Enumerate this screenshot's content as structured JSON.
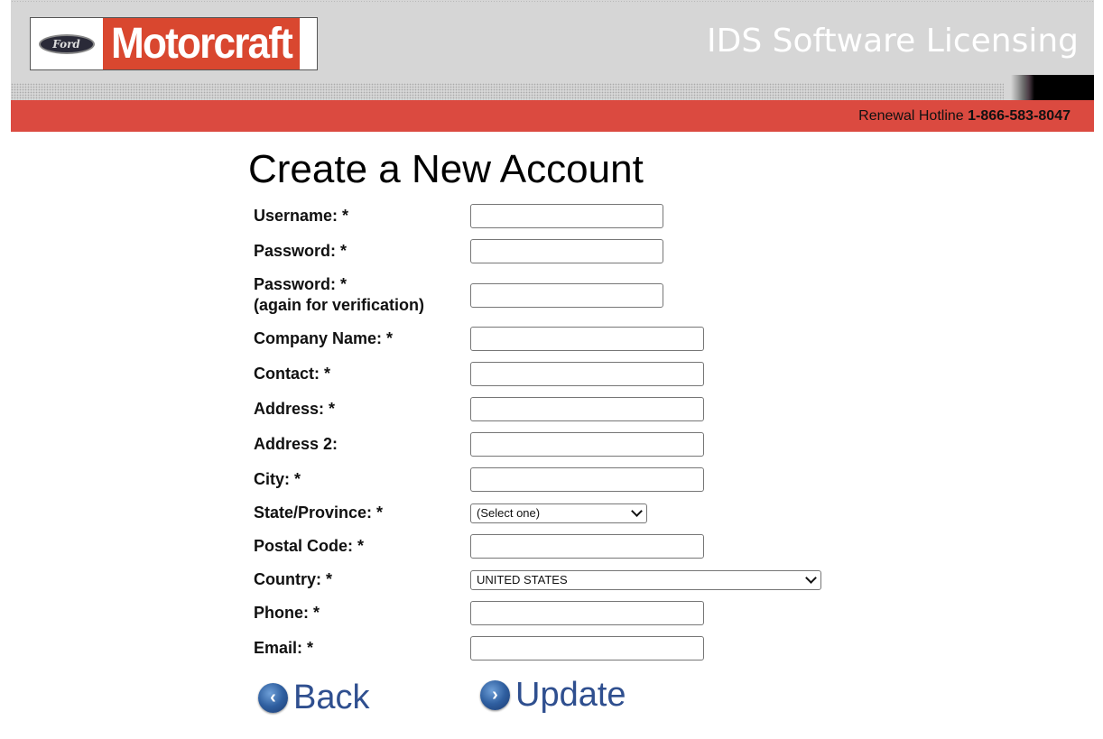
{
  "header": {
    "logo_brand": "Motorcraft",
    "logo_ford": "Ford",
    "app_title": "IDS Software Licensing",
    "hotline_label": "Renewal Hotline",
    "hotline_number": "1-866-583-8047"
  },
  "page": {
    "title": "Create a New Account"
  },
  "form": {
    "username_label": "Username: *",
    "password_label": "Password: *",
    "password2_label_line1": "Password: *",
    "password2_label_line2": "(again for verification)",
    "company_label": "Company Name: *",
    "contact_label": "Contact: *",
    "address_label": "Address: *",
    "address2_label": "Address 2:",
    "city_label": "City: *",
    "state_label": "State/Province: *",
    "state_value": "(Select one)",
    "postal_label": "Postal Code: *",
    "country_label": "Country: *",
    "country_value": "UNITED STATES",
    "phone_label": "Phone: *",
    "email_label": "Email: *"
  },
  "actions": {
    "back_label": "Back",
    "back_icon": "chevron-left-circle-icon",
    "update_label": "Update",
    "update_icon": "chevron-right-circle-icon"
  }
}
